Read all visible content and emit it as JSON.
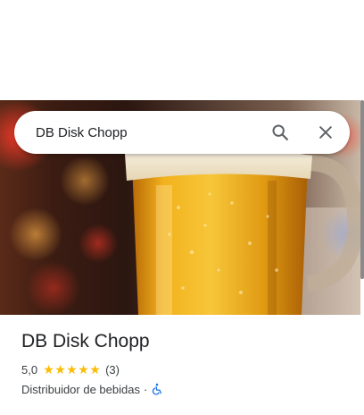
{
  "search": {
    "value": "DB Disk Chopp",
    "search_icon": "search-icon",
    "close_icon": "close-icon"
  },
  "place": {
    "name": "DB Disk Chopp",
    "rating": "5,0",
    "stars": 5,
    "review_count": "(3)",
    "category": "Distribuidor de bebidas",
    "separator": "·",
    "accessibility_icon": "wheelchair-accessible-icon"
  },
  "colors": {
    "star": "#fbbc04",
    "accessibility": "#1a73e8",
    "text_primary": "#202124",
    "text_secondary": "#3c4043"
  }
}
